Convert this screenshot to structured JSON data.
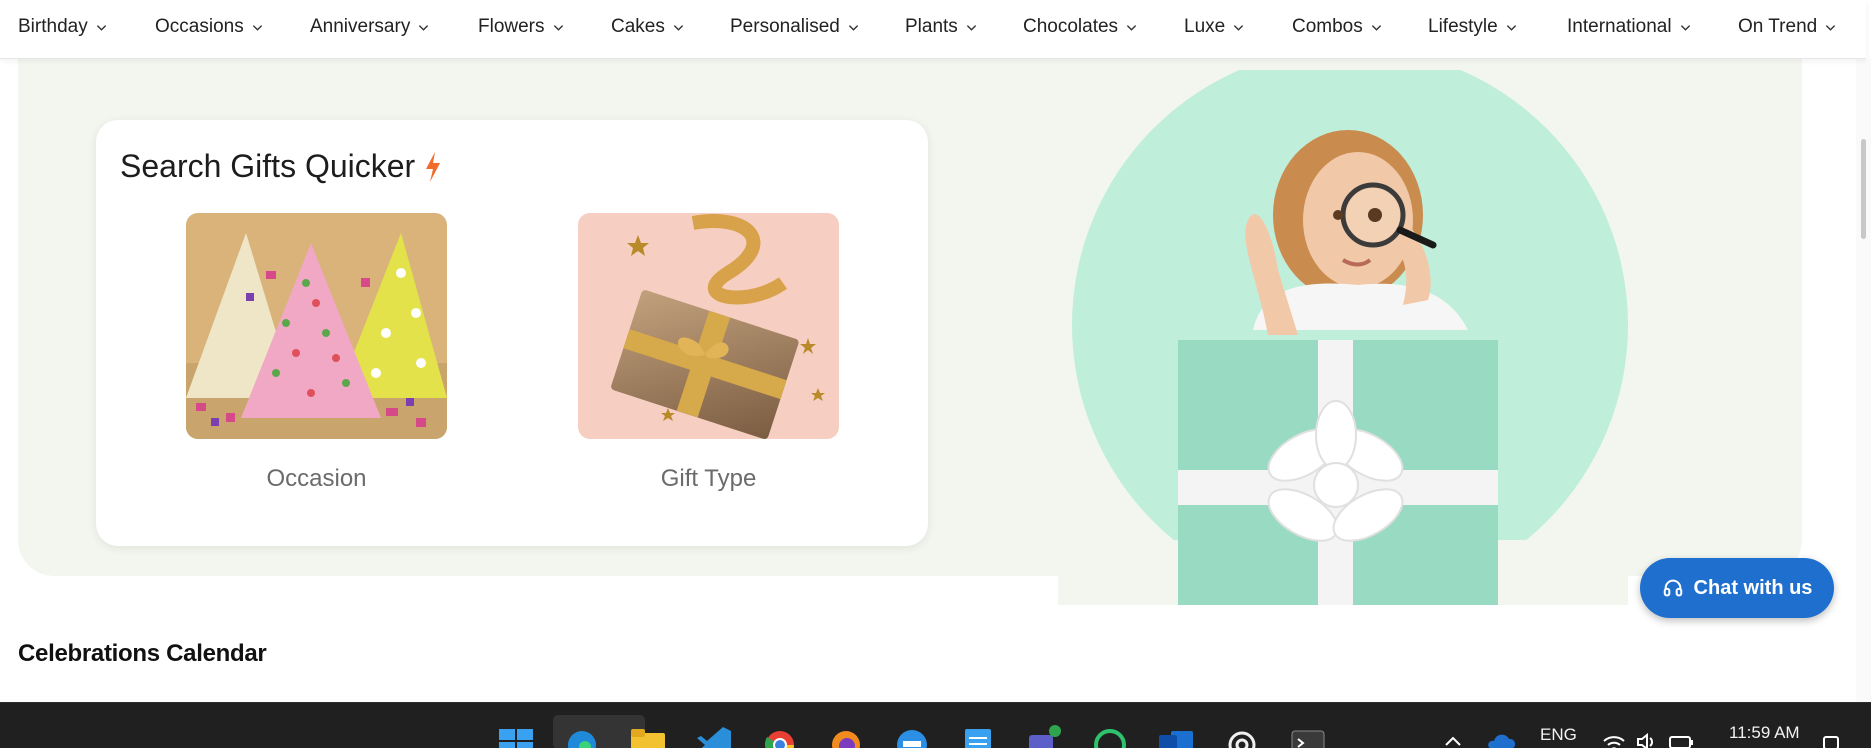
{
  "nav": {
    "items": [
      {
        "label": "Birthday"
      },
      {
        "label": "Occasions"
      },
      {
        "label": "Anniversary"
      },
      {
        "label": "Flowers"
      },
      {
        "label": "Cakes"
      },
      {
        "label": "Personalised"
      },
      {
        "label": "Plants"
      },
      {
        "label": "Chocolates"
      },
      {
        "label": "Luxe"
      },
      {
        "label": "Combos"
      },
      {
        "label": "Lifestyle"
      },
      {
        "label": "International"
      },
      {
        "label": "On Trend"
      }
    ]
  },
  "search_card": {
    "title": "Search Gifts Quicker",
    "title_icon": "lightning-bolt-icon",
    "tiles": [
      {
        "label": "Occasion",
        "image": "party-hats-image"
      },
      {
        "label": "Gift Type",
        "image": "gift-box-image"
      }
    ]
  },
  "hero_illustration": "woman-with-magnifying-glass-in-gift-box",
  "chat": {
    "label": "Chat with us",
    "icon": "headset-icon"
  },
  "section": {
    "heading": "Celebrations Calendar"
  },
  "taskbar": {
    "apps": [
      "windows-start-icon",
      "edge-icon",
      "file-explorer-icon",
      "vscode-icon",
      "chrome-icon",
      "firefox-icon",
      "docker-icon",
      "notepad-icon",
      "teams-icon",
      "whatsapp-icon",
      "outlook-icon",
      "chatgpt-icon",
      "terminal-icon"
    ],
    "language": "ENG",
    "time": "11:59 AM"
  },
  "colors": {
    "hero_bg": "#f3f6ef",
    "mint_circle": "#bfeedb",
    "chat_button": "#1f6fce",
    "bolt": "#f26b2a"
  }
}
